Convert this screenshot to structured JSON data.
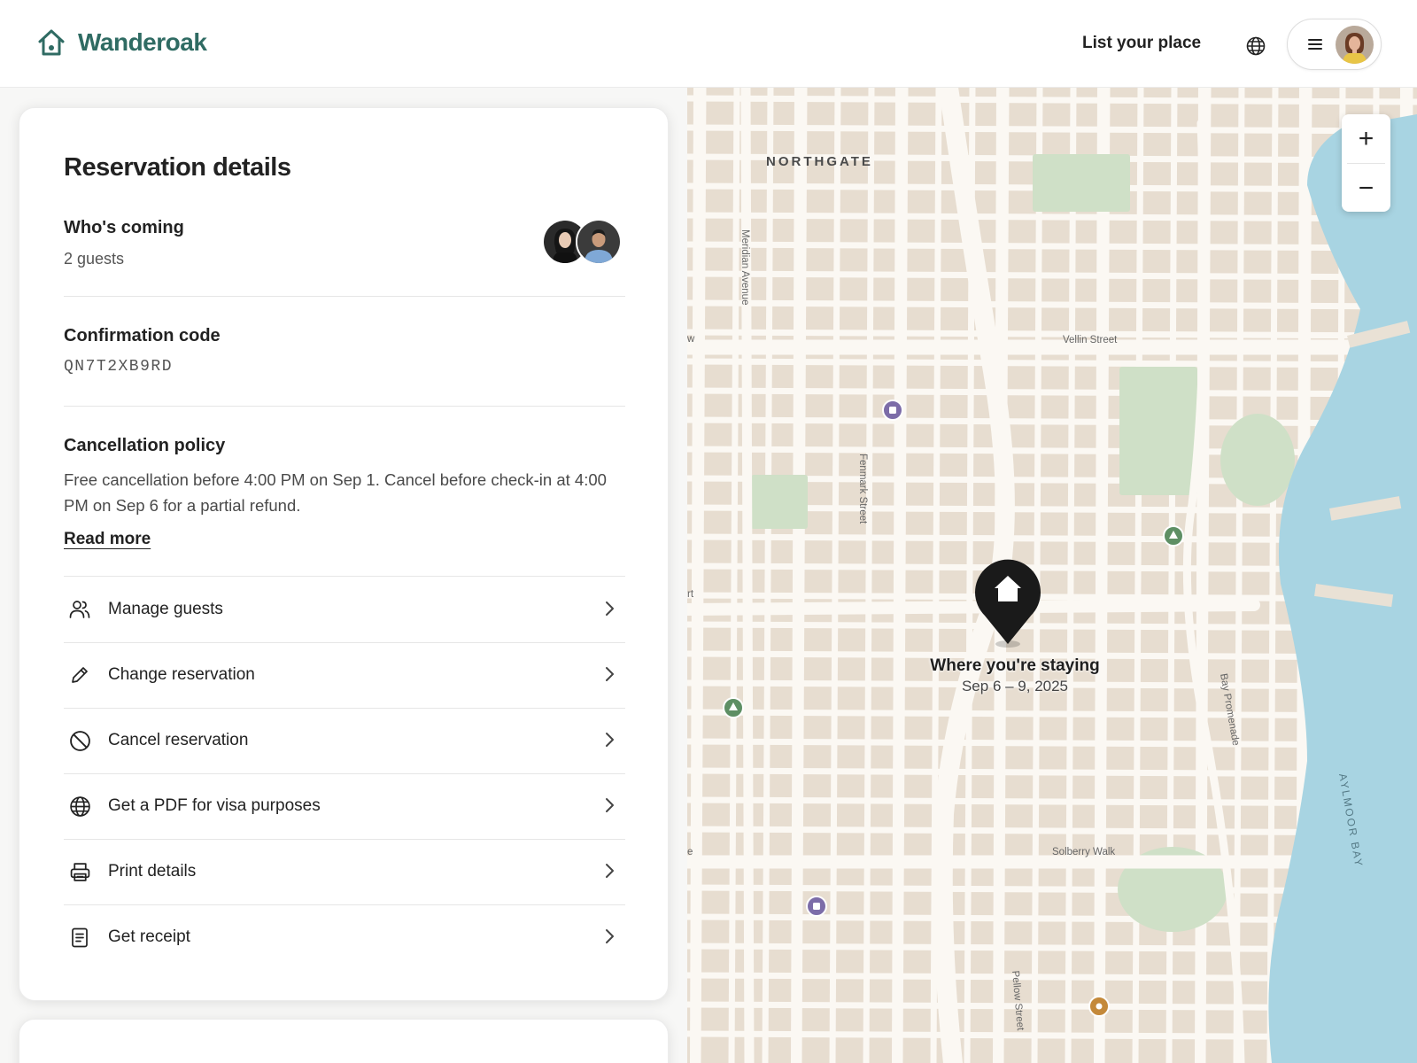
{
  "header": {
    "brand": "Wanderoak",
    "host_link": "List your place",
    "icons": [
      "home-icon",
      "globe-icon",
      "menu-icon"
    ]
  },
  "reservation": {
    "title": "Reservation details",
    "whos_coming": {
      "label": "Who's coming",
      "value": "2 guests"
    },
    "confirmation": {
      "label": "Confirmation code",
      "value": "QN7T2XB9RD"
    },
    "cancellation": {
      "label": "Cancellation policy",
      "text": "Free cancellation before 4:00 PM on Sep 1. Cancel before check-in at 4:00 PM on Sep 6 for a partial refund.",
      "read_more": "Read more"
    },
    "actions": [
      {
        "label": "Manage guests",
        "icon": "users-icon"
      },
      {
        "label": "Change reservation",
        "icon": "pencil-icon"
      },
      {
        "label": "Cancel reservation",
        "icon": "ban-icon"
      },
      {
        "label": "Get a PDF for visa purposes",
        "icon": "globe-icon"
      },
      {
        "label": "Print details",
        "icon": "printer-icon"
      },
      {
        "label": "Get receipt",
        "icon": "receipt-icon"
      }
    ]
  },
  "map": {
    "district": "NORTHGATE",
    "bay": "AYLMOOR BAY",
    "streets": {
      "meridian": "Meridian Avenue",
      "vellin": "Vellin Street",
      "fenmark": "Fenmark Street",
      "bay_promenade": "Bay Promenade",
      "solberry": "Solberry Walk",
      "pellow": "Pellow Street"
    },
    "edge_labels": {
      "w": "w",
      "rt": "rt",
      "e": "e"
    },
    "pin": {
      "title": "Where you're staying",
      "dates": "Sep 6 – 9, 2025"
    },
    "zoom_in": "+",
    "zoom_out": "−",
    "colors": {
      "land": "#e7ddd0",
      "water": "#a8d4e2",
      "park": "#cfe0c7",
      "road": "#ffffff",
      "pin": "#1a1a1a",
      "brand": "#2f6b63"
    }
  }
}
